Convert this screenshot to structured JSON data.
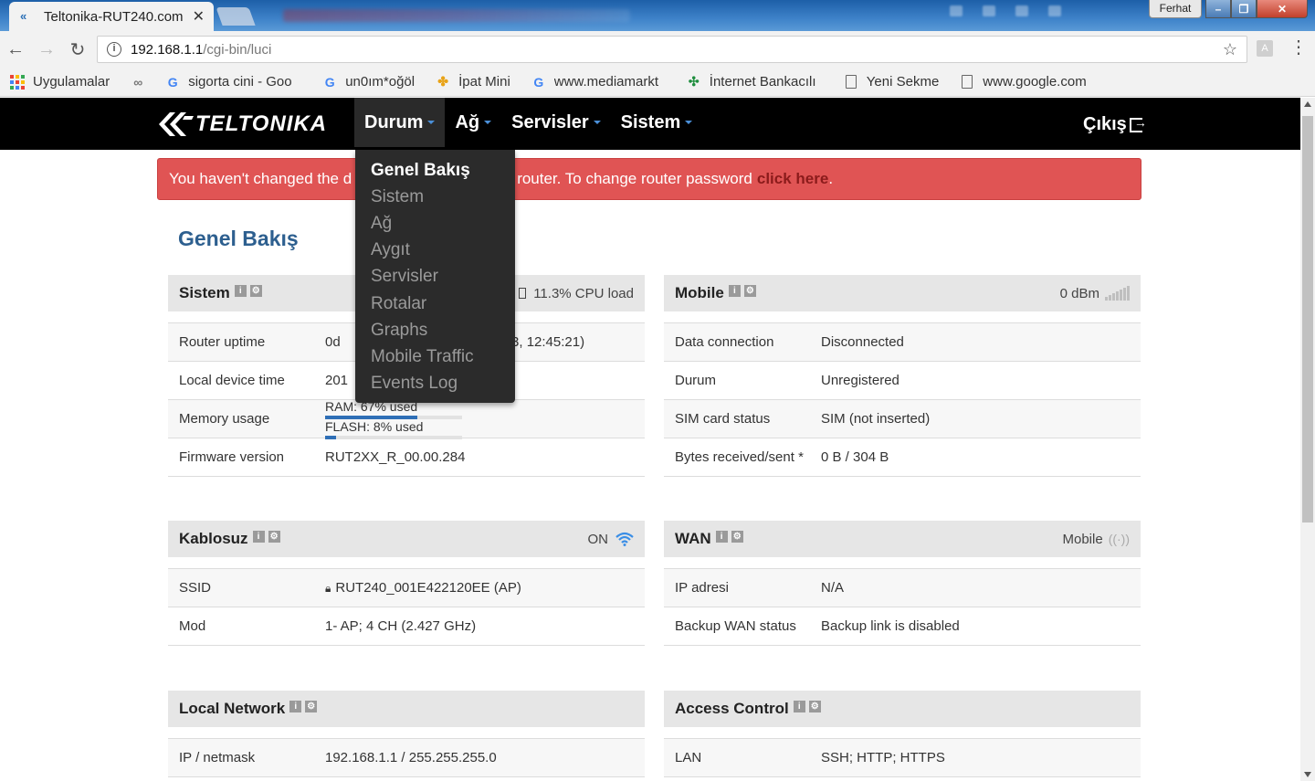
{
  "browser": {
    "tab_title": "Teltonika-RUT240.com",
    "user": "Ferhat",
    "url_host": "192.168.1.1",
    "url_path": "/cgi-bin/luci",
    "bookmarks": [
      {
        "label": "Uygulamalar",
        "icon": "apps-grid-icon"
      },
      {
        "label": "",
        "icon": "glasses-icon"
      },
      {
        "label": "sigorta cini - Goo",
        "icon": "google-icon"
      },
      {
        "label": "un0ım*oğöl",
        "icon": "google-icon"
      },
      {
        "label": "İpat Mini",
        "icon": "pinwheel-icon"
      },
      {
        "label": "www.mediamarkt",
        "icon": "google-icon"
      },
      {
        "label": "İnternet Bankacılı",
        "icon": "clover-icon"
      },
      {
        "label": "Yeni Sekme",
        "icon": "document-icon"
      },
      {
        "label": "www.google.com",
        "icon": "document-icon"
      }
    ]
  },
  "navbar": {
    "logo": "TELTONIKA",
    "menu": [
      "Durum",
      "Ağ",
      "Servisler",
      "Sistem"
    ],
    "logout": "Çıkış"
  },
  "dropdown": [
    "Genel Bakış",
    "Sistem",
    "Ağ",
    "Aygıt",
    "Servisler",
    "Rotalar",
    "Graphs",
    "Mobile Traffic",
    "Events Log"
  ],
  "alert": {
    "text_visible_left": "You haven't changed the d",
    "text_visible_right": "router. To change router password",
    "link": "click here",
    "end": "."
  },
  "page_title": "Genel Bakış",
  "panels": {
    "sistem": {
      "title": "Sistem",
      "right": "11.3% CPU load",
      "rows": [
        {
          "k": "Router uptime",
          "v_left": "0d",
          "v_right": "03, 12:45:21)"
        },
        {
          "k": "Local device time",
          "v_left": "201",
          "v_right": ""
        },
        {
          "k": "Memory usage"
        },
        {
          "k": "Firmware version",
          "v_left": "RUT2XX_R_00.00.284",
          "v_right": ""
        }
      ],
      "ram_label": "RAM: 67% used",
      "ram_pct": 67,
      "flash_label": "FLASH: 8% used",
      "flash_pct": 8
    },
    "mobile": {
      "title": "Mobile",
      "right": "0 dBm",
      "rows": [
        {
          "k": "Data connection",
          "v": "Disconnected"
        },
        {
          "k": "Durum",
          "v": "Unregistered"
        },
        {
          "k": "SIM card status",
          "v": "SIM (not inserted)"
        },
        {
          "k": "Bytes received/sent *",
          "v": "0 B / 304 B"
        }
      ]
    },
    "kablosuz": {
      "title": "Kablosuz",
      "right": "ON",
      "rows": [
        {
          "k": "SSID",
          "v": "RUT240_001E422120EE (AP)"
        },
        {
          "k": "Mod",
          "v": "1- AP; 4 CH (2.427 GHz)"
        }
      ]
    },
    "wan": {
      "title": "WAN",
      "right": "Mobile",
      "rows": [
        {
          "k": "IP adresi",
          "v": "N/A"
        },
        {
          "k": "Backup WAN status",
          "v": "Backup link is disabled"
        }
      ]
    },
    "local": {
      "title": "Local Network",
      "rows": [
        {
          "k": "IP / netmask",
          "v": "192.168.1.1 / 255.255.255.0"
        }
      ]
    },
    "access": {
      "title": "Access Control",
      "rows": [
        {
          "k": "LAN",
          "v": "SSH; HTTP; HTTPS"
        }
      ]
    }
  },
  "colors": {
    "navbar": "#000000",
    "alert": "#e05454",
    "title": "#2d5f8f",
    "bar_fill": "#2f6fb6",
    "caret": "#4a8fd8"
  }
}
